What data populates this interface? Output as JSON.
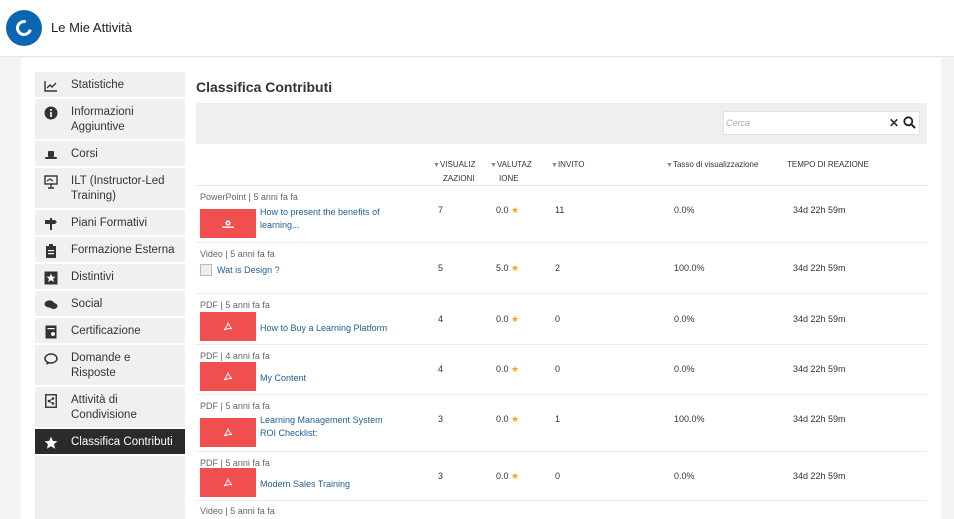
{
  "app": {
    "title": "Le Mie Attività"
  },
  "sidebar": {
    "items": [
      {
        "label": "Statistiche",
        "icon": "chart-icon",
        "glyph": "📈"
      },
      {
        "label": "Informazioni Aggiuntive",
        "icon": "info-icon",
        "glyph": "ℹ"
      },
      {
        "label": "Corsi",
        "icon": "hat-icon",
        "glyph": "🎩"
      },
      {
        "label": "ILT (Instructor-Led Training)",
        "icon": "presentation-icon",
        "glyph": "⛶"
      },
      {
        "label": "Piani Formativi",
        "icon": "signpost-icon",
        "glyph": "⊤"
      },
      {
        "label": "Formazione Esterna",
        "icon": "clipboard-icon",
        "glyph": "📋"
      },
      {
        "label": "Distintivi",
        "icon": "badge-icon",
        "glyph": "★"
      },
      {
        "label": "Social",
        "icon": "chat-bubbles-icon",
        "glyph": "💬"
      },
      {
        "label": "Certificazione",
        "icon": "certificate-icon",
        "glyph": "▣"
      },
      {
        "label": "Domande e Risposte",
        "icon": "question-bubble-icon",
        "glyph": "🗨"
      },
      {
        "label": "Attività di Condivisione",
        "icon": "share-doc-icon",
        "glyph": "⎘"
      },
      {
        "label": "Classifica Contributi",
        "icon": "star-icon",
        "glyph": "★"
      }
    ]
  },
  "main": {
    "title": "Classifica Contributi",
    "search": {
      "placeholder": "Cerca",
      "clear_glyph": "✕"
    },
    "columns": {
      "views_line1": "VISUALIZ",
      "views_line2": "ZAZIONI",
      "rating_line1": "VALUTAZ",
      "rating_line2": "IONE",
      "invite": "INVITO",
      "view_rate": "Tasso di visualizzazione",
      "reaction_time": "TEMPO DI REAZIONE"
    },
    "rows": [
      {
        "meta": "PowerPoint | 5 anni fa fa",
        "title": "How to present the benefits of learning...",
        "thumb": "ppt",
        "views": "7",
        "rating": "0.0",
        "invite": "11",
        "rate": "0.0%",
        "reaction": "34d 22h 59m"
      },
      {
        "meta": "Video | 5 anni fa fa",
        "title": "Wat is Design ?",
        "thumb": "broken",
        "views": "5",
        "rating": "5.0",
        "invite": "2",
        "rate": "100.0%",
        "reaction": "34d 22h 59m"
      },
      {
        "meta": "PDF | 5 anni fa fa",
        "title": "How to Buy a Learning Platform",
        "thumb": "pdf",
        "views": "4",
        "rating": "0.0",
        "invite": "0",
        "rate": "0.0%",
        "reaction": "34d 22h 59m"
      },
      {
        "meta": "PDF | 4 anni fa fa",
        "title": "My Content",
        "thumb": "pdf",
        "views": "4",
        "rating": "0.0",
        "invite": "0",
        "rate": "0.0%",
        "reaction": "34d 22h 59m"
      },
      {
        "meta": "PDF | 5 anni fa fa",
        "title": "Learning Management System ROI Checklist:",
        "thumb": "pdf",
        "views": "3",
        "rating": "0.0",
        "invite": "1",
        "rate": "100.0%",
        "reaction": "34d 22h 59m"
      },
      {
        "meta": "PDF | 5 anni fa fa",
        "title": "Modern Sales Training",
        "thumb": "pdf",
        "views": "3",
        "rating": "0.0",
        "invite": "0",
        "rate": "0.0%",
        "reaction": "34d 22h 59m"
      },
      {
        "meta": "Video | 5 anni fa fa",
        "title": "",
        "thumb": "",
        "views": "",
        "rating": "",
        "invite": "",
        "rate": "",
        "reaction": ""
      }
    ]
  },
  "colors": {
    "accent": "#0b67b2",
    "thumb": "#ef4f4f",
    "link": "#1f5f98",
    "star": "#f0a422",
    "active_nav": "#2b2b2b"
  }
}
